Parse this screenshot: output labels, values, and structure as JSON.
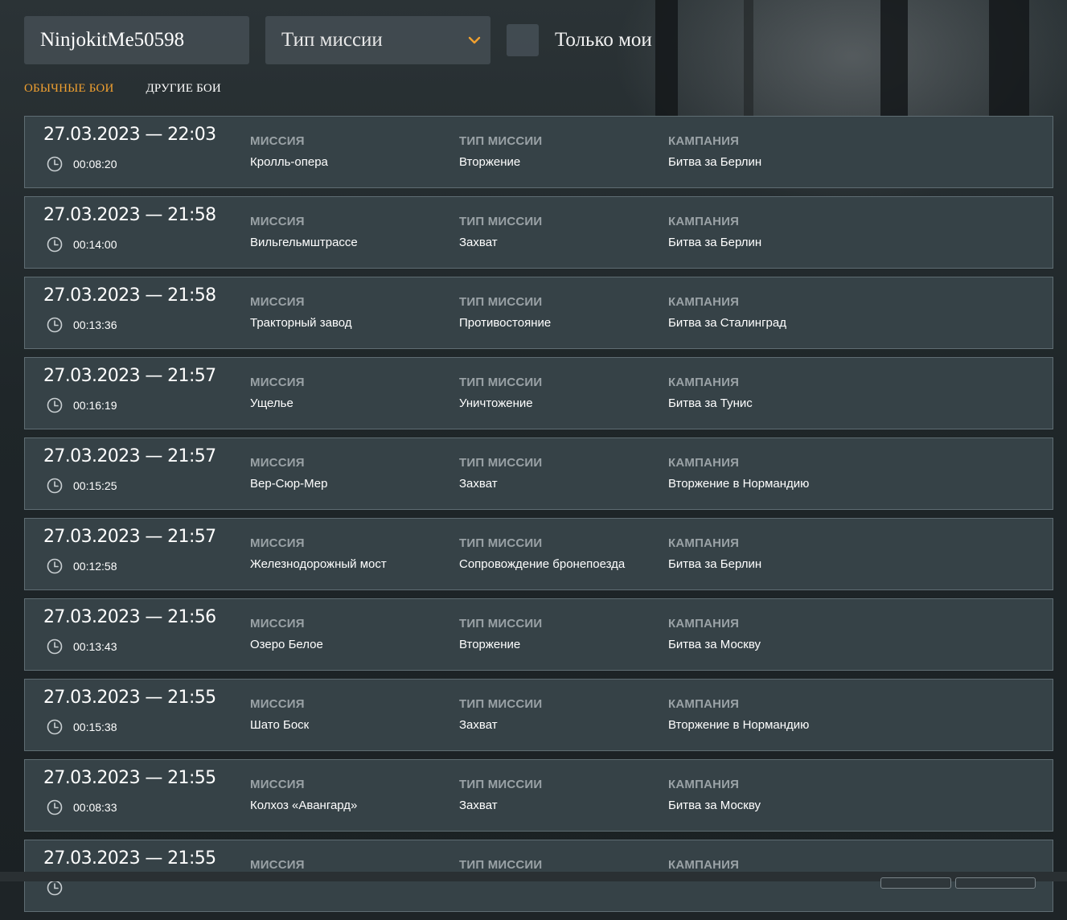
{
  "filters": {
    "player_name": "NinjokitMe50598",
    "mission_type_select": "Тип миссии",
    "only_mine_label": "Только мои"
  },
  "tabs": [
    {
      "label": "Обычные бои",
      "active": true
    },
    {
      "label": "Другие бои",
      "active": false
    }
  ],
  "column_headers": {
    "mission": "Миссия",
    "mission_type": "Тип миссии",
    "campaign": "Кампания"
  },
  "battles": [
    {
      "datetime": "27.03.2023 — 22:03",
      "duration": "00:08:20",
      "mission": "Кролль-опера",
      "mission_type": "Вторжение",
      "campaign": "Битва за Берлин"
    },
    {
      "datetime": "27.03.2023 — 21:58",
      "duration": "00:14:00",
      "mission": "Вильгельмштрассе",
      "mission_type": "Захват",
      "campaign": "Битва за Берлин"
    },
    {
      "datetime": "27.03.2023 — 21:58",
      "duration": "00:13:36",
      "mission": "Тракторный завод",
      "mission_type": "Противостояние",
      "campaign": "Битва за Сталинград"
    },
    {
      "datetime": "27.03.2023 — 21:57",
      "duration": "00:16:19",
      "mission": "Ущелье",
      "mission_type": "Уничтожение",
      "campaign": "Битва за Тунис"
    },
    {
      "datetime": "27.03.2023 — 21:57",
      "duration": "00:15:25",
      "mission": "Вер-Сюр-Мер",
      "mission_type": "Захват",
      "campaign": "Вторжение в Нормандию"
    },
    {
      "datetime": "27.03.2023 — 21:57",
      "duration": "00:12:58",
      "mission": "Железнодорожный мост",
      "mission_type": "Сопровождение бронепоезда",
      "campaign": "Битва за Берлин"
    },
    {
      "datetime": "27.03.2023 — 21:56",
      "duration": "00:13:43",
      "mission": "Озеро Белое",
      "mission_type": "Вторжение",
      "campaign": "Битва за Москву"
    },
    {
      "datetime": "27.03.2023 — 21:55",
      "duration": "00:15:38",
      "mission": "Шато Боск",
      "mission_type": "Захват",
      "campaign": "Вторжение в Нормандию"
    },
    {
      "datetime": "27.03.2023 — 21:55",
      "duration": "00:08:33",
      "mission": "Колхоз «Авангард»",
      "mission_type": "Захват",
      "campaign": "Битва за Москву"
    },
    {
      "datetime": "27.03.2023 — 21:55",
      "duration": "",
      "mission": "",
      "mission_type": "",
      "campaign": ""
    }
  ],
  "colors": {
    "accent": "#f0a030",
    "card_bg": "#364247",
    "card_border": "#5f6d73",
    "header_text": "#9aa2a6"
  }
}
